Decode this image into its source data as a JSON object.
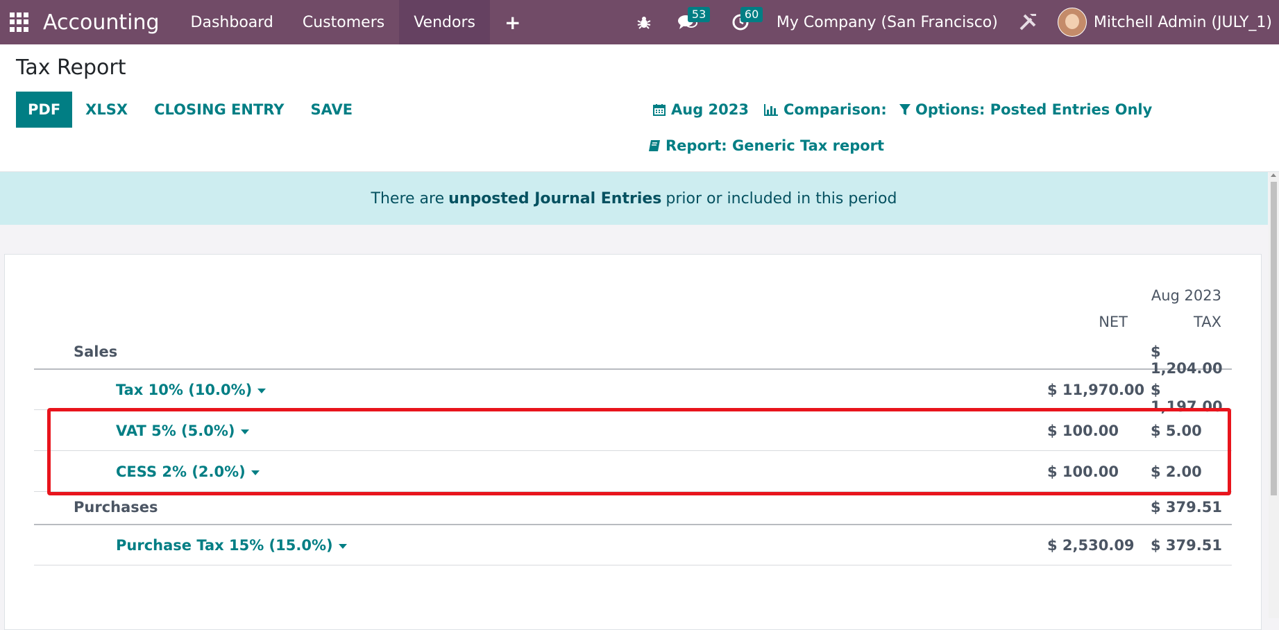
{
  "navbar": {
    "app_name": "Accounting",
    "items": [
      {
        "label": "Dashboard"
      },
      {
        "label": "Customers"
      },
      {
        "label": "Vendors",
        "active": true
      }
    ],
    "plus_label": "+",
    "messages_count": "53",
    "activities_count": "60",
    "company": "My Company (San Francisco)",
    "user": "Mitchell Admin (JULY_1)",
    "brand_color": "#714b67"
  },
  "control_panel": {
    "title": "Tax Report",
    "buttons": {
      "pdf": "PDF",
      "xlsx": "XLSX",
      "closing_entry": "CLOSING ENTRY",
      "save": "SAVE"
    },
    "filters": {
      "date": "Aug 2023",
      "comparison": "Comparison:",
      "options": "Options: Posted Entries Only",
      "report": "Report: Generic Tax report"
    }
  },
  "alert": {
    "prefix": "There are",
    "emphasis": "unposted Journal Entries",
    "suffix": "prior or included in this period"
  },
  "report": {
    "period": "Aug 2023",
    "columns": {
      "net": "NET",
      "tax": "TAX"
    },
    "rows": [
      {
        "name": "Sales",
        "net": "",
        "tax": "$ 1,204.00"
      },
      {
        "name": "Tax 10% (10.0%)",
        "net": "$ 11,970.00",
        "tax": "$ 1,197.00"
      },
      {
        "name": "VAT 5% (5.0%)",
        "net": "$ 100.00",
        "tax": "$ 5.00"
      },
      {
        "name": "CESS 2% (2.0%)",
        "net": "$ 100.00",
        "tax": "$ 2.00"
      },
      {
        "name": "Purchases",
        "net": "",
        "tax": "$ 379.51"
      },
      {
        "name": "Purchase Tax 15% (15.0%)",
        "net": "$ 2,530.09",
        "tax": "$ 379.51"
      }
    ]
  },
  "accent_color": "#017e84",
  "highlight_color": "#e8141c"
}
